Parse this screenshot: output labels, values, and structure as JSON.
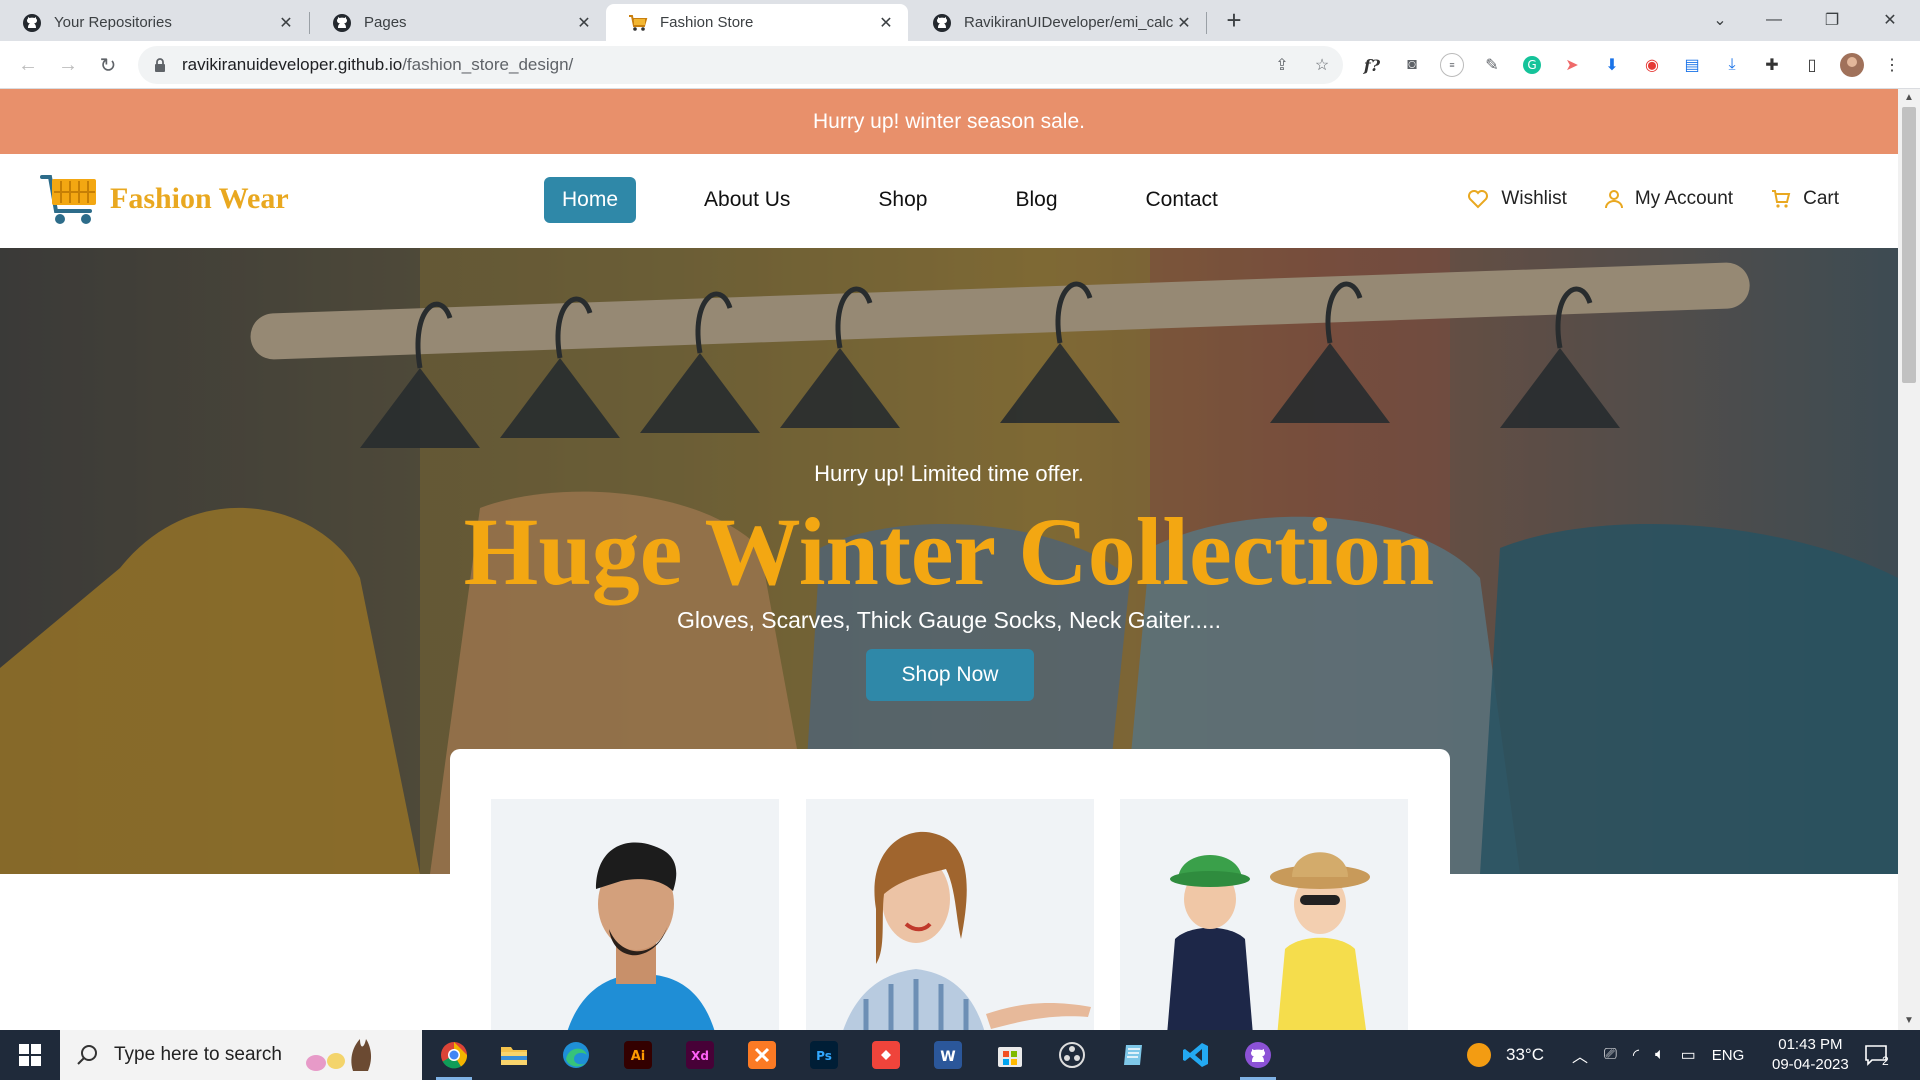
{
  "browser": {
    "tabs": [
      {
        "label": "Your Repositories",
        "icon": "github-icon",
        "active": false
      },
      {
        "label": "Pages",
        "icon": "github-icon",
        "active": false
      },
      {
        "label": "Fashion Store",
        "icon": "cart-icon",
        "active": true
      },
      {
        "label": "RavikiranUIDeveloper/emi_calcul",
        "icon": "github-icon",
        "active": false
      }
    ],
    "url_host": "ravikiranuideveloper.github.io",
    "url_path": "/fashion_store_design/"
  },
  "page": {
    "promo": "Hurry up! winter season sale.",
    "logo_text": "Fashion Wear",
    "nav": [
      "Home",
      "About Us",
      "Shop",
      "Blog",
      "Contact"
    ],
    "active_nav": "Home",
    "utility": {
      "wishlist": "Wishlist",
      "account": "My Account",
      "cart": "Cart"
    },
    "hero": {
      "kicker": "Hurry up! Limited time offer.",
      "title": "Huge Winter Collection",
      "subtitle": "Gloves, Scarves, Thick Gauge Socks, Neck Gaiter.....",
      "cta": "Shop Now"
    },
    "categories": [
      "men-category-image",
      "women-category-image",
      "kids-category-image"
    ],
    "colors": {
      "promo": "#e8906b",
      "accent": "#2f88a8",
      "title": "#f3a712",
      "logo": "#e9a820"
    }
  },
  "taskbar": {
    "search_placeholder": "Type here to search",
    "weather": "33°C",
    "language": "ENG",
    "time": "01:43 PM",
    "date": "09-04-2023",
    "notifications": "2"
  }
}
